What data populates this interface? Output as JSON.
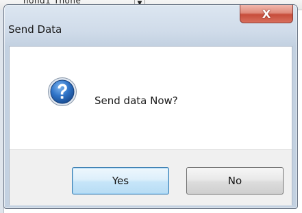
{
  "background_window": {
    "partial_text": "nond1 Tnone"
  },
  "dialog": {
    "title": "Send Data",
    "close_glyph": "X",
    "message": "Send data Now?",
    "icon": "question-icon",
    "buttons": {
      "yes_label": "Yes",
      "no_label": "No"
    },
    "colors": {
      "title_bar": "#cfdbe9",
      "close_button": "#c74d3b",
      "default_button_border": "#3c7fb1",
      "icon_blue": "#1f5fb0"
    }
  }
}
